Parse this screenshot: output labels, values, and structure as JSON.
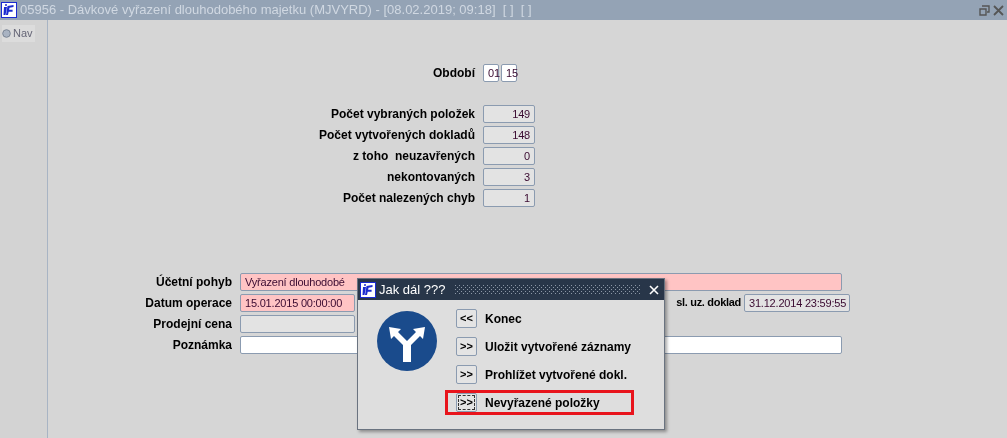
{
  "window": {
    "title": "05956 - Dávkové vyřazení dlouhodobého majetku (MJVYRD) - [08.02.2019; 09:18]  [ ]  [ ]"
  },
  "sidebar": {
    "tab": "Nav"
  },
  "period": {
    "label": "Období",
    "month": "01",
    "year": "15"
  },
  "counts": [
    {
      "label": "Počet vybraných položek",
      "value": "149"
    },
    {
      "label": "Počet vytvořených dokladů",
      "value": "148"
    },
    {
      "label": "z toho  neuzavřených",
      "value": "0"
    },
    {
      "label": "nekontovaných",
      "value": "3"
    },
    {
      "label": "Počet nalezených chyb",
      "value": "1"
    }
  ],
  "form": [
    {
      "label": "Účetní pohyb",
      "value": "Vyřazení dlouhodobé",
      "required": true,
      "kind": "wide"
    },
    {
      "label": "Datum operace",
      "value": "15.01.2015 00:00:00",
      "required": true,
      "kind": "date",
      "side_label": "sl. uz. doklad",
      "side_value": "31.12.2014 23:59:55"
    },
    {
      "label": "Prodejní cena",
      "required": false,
      "kind": "readonly"
    },
    {
      "label": "Poznámka",
      "required": false,
      "kind": "wide"
    }
  ],
  "dialog": {
    "title": "Jak dál ???",
    "actions": [
      {
        "button": "<<",
        "label": "Konec",
        "selected": false
      },
      {
        "button": ">>",
        "label": "Uložit vytvořené záznamy",
        "selected": false
      },
      {
        "button": ">>",
        "label": "Prohlížet vytvořené dokl.",
        "selected": false
      },
      {
        "button": ">>",
        "label": "Nevyřazené položky",
        "selected": true
      }
    ]
  }
}
